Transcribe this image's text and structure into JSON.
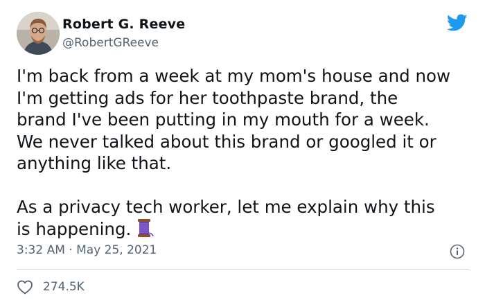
{
  "author": {
    "name": "Robert G. Reeve",
    "handle": "@RobertGReeve"
  },
  "tweet": {
    "text": "I'm back from a week at my mom's house and now\nI'm getting ads for her toothpaste brand, the\nbrand I've been putting in my mouth for a week.\nWe never talked about this brand or googled it or\nanything like that.\n\nAs a privacy tech worker, let me explain why this\nis happening.",
    "emoji": "thread-spool-icon",
    "time": "3:32 AM",
    "separator": "·",
    "date": "May 25, 2021"
  },
  "engagement": {
    "likes": "274.5K"
  },
  "colors": {
    "brand_blue": "#1d9bf0",
    "text": "#0f1419",
    "secondary": "#536471",
    "divider": "#cfd9de"
  }
}
